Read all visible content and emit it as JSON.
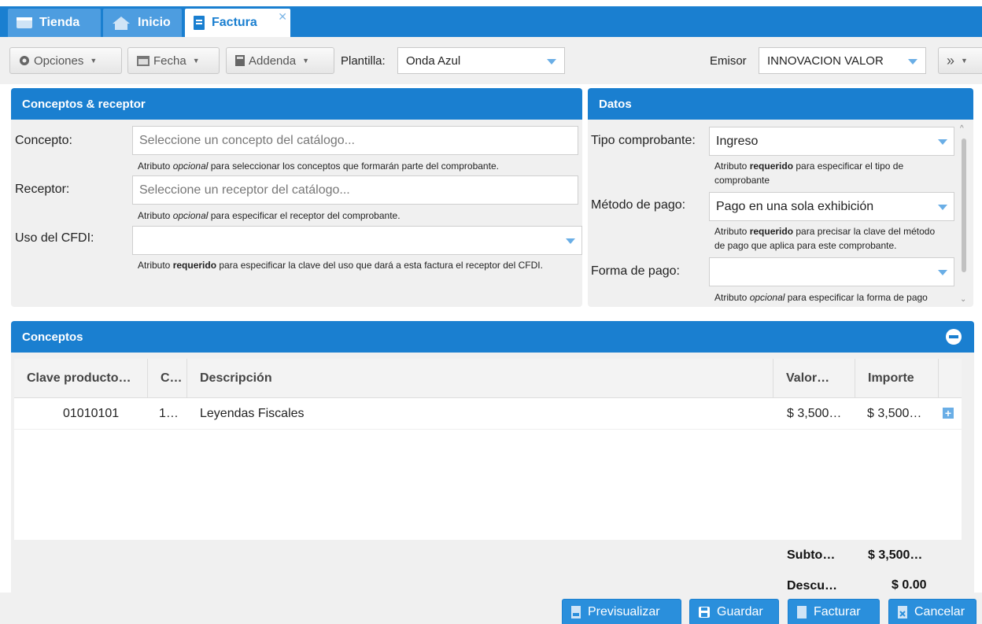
{
  "tabs": [
    {
      "label": "Tienda"
    },
    {
      "label": "Inicio"
    },
    {
      "label": "Factura"
    }
  ],
  "toolbar": {
    "options_label": "Opciones",
    "date_label": "Fecha",
    "addenda_label": "Addenda",
    "template_label": "Plantilla:",
    "template_value": "Onda Azul",
    "emisor_label": "Emisor",
    "emisor_value": "INNOVACION VALOR",
    "more_label": "»"
  },
  "conceptos_receptor": {
    "title": "Conceptos & receptor",
    "concepto_label": "Concepto:",
    "concepto_placeholder": "Seleccione un concepto del catálogo...",
    "concepto_hint_pre": "Atributo ",
    "concepto_hint_em": "opcional",
    "concepto_hint_post": " para seleccionar los conceptos que formarán parte del comprobante.",
    "receptor_label": "Receptor:",
    "receptor_placeholder": "Seleccione un receptor del catálogo...",
    "receptor_hint_pre": "Atributo ",
    "receptor_hint_em": "opcional",
    "receptor_hint_post": " para especificar el receptor del comprobante.",
    "uso_label": "Uso del CFDI:",
    "uso_value": "",
    "uso_hint_pre": "Atributo ",
    "uso_hint_b": "requerido",
    "uso_hint_post": " para especificar la clave del uso que dará a esta factura el receptor del CFDI."
  },
  "datos": {
    "title": "Datos",
    "tipo_label": "Tipo comprobante:",
    "tipo_value": "Ingreso",
    "tipo_hint_pre": "Atributo ",
    "tipo_hint_b": "requerido",
    "tipo_hint_post": " para especificar el tipo de",
    "tipo_hint_line2": "comprobante",
    "metodo_label": "Método de pago:",
    "metodo_value": "Pago en una sola exhibición",
    "metodo_hint_pre": "Atributo ",
    "metodo_hint_b": "requerido",
    "metodo_hint_post": " para precisar la clave del método",
    "metodo_hint_line2": "de pago que aplica para este comprobante.",
    "forma_label": "Forma de pago:",
    "forma_value": "",
    "forma_hint_pre": "Atributo ",
    "forma_hint_em": "opcional",
    "forma_hint_post": " para especificar la forma de pago"
  },
  "conceptos": {
    "title": "Conceptos",
    "columns": [
      "Clave producto…",
      "C…",
      "Descripción",
      "Valor…",
      "Importe"
    ],
    "rows": [
      {
        "clave": "01010101",
        "cantidad": "1…",
        "descripcion": "Leyendas Fiscales",
        "valor": "$ 3,500…",
        "importe": "$ 3,500…"
      }
    ],
    "subtotal_label": "Subto…",
    "subtotal_value": "$ 3,500…",
    "descuento_label": "Descu…",
    "descuento_value": "$ 0.00"
  },
  "footer": {
    "preview_label": "Previsualizar",
    "save_label": "Guardar",
    "invoice_label": "Facturar",
    "cancel_label": "Cancelar"
  },
  "colors": {
    "primary": "#1a7fd0",
    "button": "#2a8fdc",
    "panel_bg": "#f0f0f0"
  }
}
